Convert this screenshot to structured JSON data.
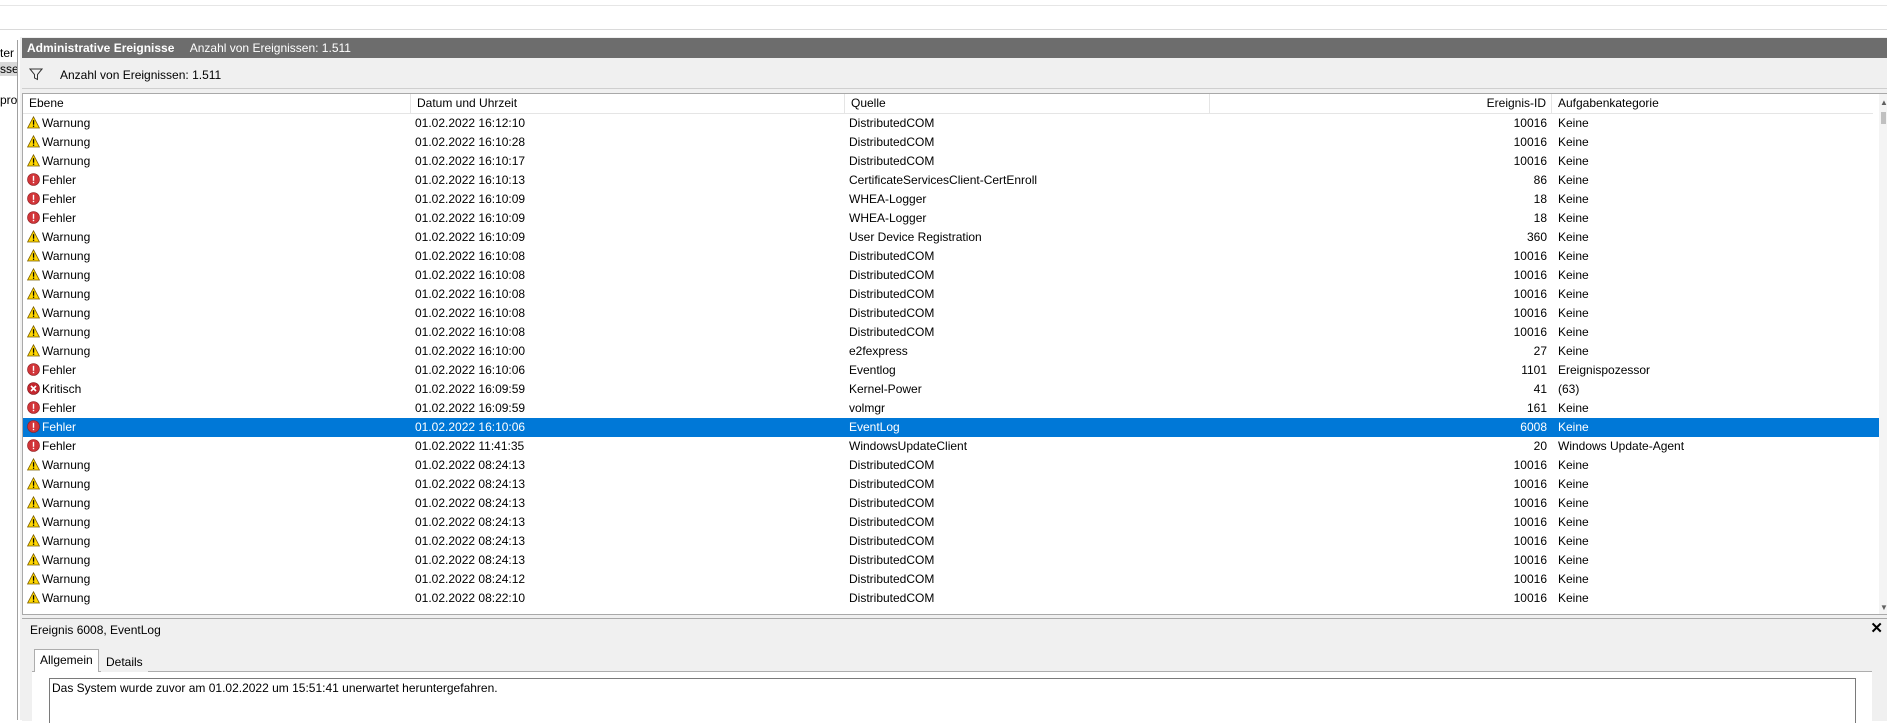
{
  "left_strip": {
    "fragments": [
      "ter",
      "sse",
      "pro"
    ]
  },
  "header": {
    "title": "Administrative Ereignisse",
    "count": "Anzahl von Ereignissen: 1.511"
  },
  "filter": {
    "count": "Anzahl von Ereignissen: 1.511",
    "icon": "filter-icon"
  },
  "columns": {
    "level": "Ebene",
    "date": "Datum und Uhrzeit",
    "source": "Quelle",
    "event_id": "Ereignis-ID",
    "category": "Aufgabenkategorie"
  },
  "events": [
    {
      "level": "Warnung",
      "icon": "warning",
      "date": "01.02.2022 16:12:10",
      "source": "DistributedCOM",
      "id": "10016",
      "category": "Keine"
    },
    {
      "level": "Warnung",
      "icon": "warning",
      "date": "01.02.2022 16:10:28",
      "source": "DistributedCOM",
      "id": "10016",
      "category": "Keine"
    },
    {
      "level": "Warnung",
      "icon": "warning",
      "date": "01.02.2022 16:10:17",
      "source": "DistributedCOM",
      "id": "10016",
      "category": "Keine"
    },
    {
      "level": "Fehler",
      "icon": "error",
      "date": "01.02.2022 16:10:13",
      "source": "CertificateServicesClient-CertEnroll",
      "id": "86",
      "category": "Keine"
    },
    {
      "level": "Fehler",
      "icon": "error",
      "date": "01.02.2022 16:10:09",
      "source": "WHEA-Logger",
      "id": "18",
      "category": "Keine"
    },
    {
      "level": "Fehler",
      "icon": "error",
      "date": "01.02.2022 16:10:09",
      "source": "WHEA-Logger",
      "id": "18",
      "category": "Keine"
    },
    {
      "level": "Warnung",
      "icon": "warning",
      "date": "01.02.2022 16:10:09",
      "source": "User Device Registration",
      "id": "360",
      "category": "Keine"
    },
    {
      "level": "Warnung",
      "icon": "warning",
      "date": "01.02.2022 16:10:08",
      "source": "DistributedCOM",
      "id": "10016",
      "category": "Keine"
    },
    {
      "level": "Warnung",
      "icon": "warning",
      "date": "01.02.2022 16:10:08",
      "source": "DistributedCOM",
      "id": "10016",
      "category": "Keine"
    },
    {
      "level": "Warnung",
      "icon": "warning",
      "date": "01.02.2022 16:10:08",
      "source": "DistributedCOM",
      "id": "10016",
      "category": "Keine"
    },
    {
      "level": "Warnung",
      "icon": "warning",
      "date": "01.02.2022 16:10:08",
      "source": "DistributedCOM",
      "id": "10016",
      "category": "Keine"
    },
    {
      "level": "Warnung",
      "icon": "warning",
      "date": "01.02.2022 16:10:08",
      "source": "DistributedCOM",
      "id": "10016",
      "category": "Keine"
    },
    {
      "level": "Warnung",
      "icon": "warning",
      "date": "01.02.2022 16:10:00",
      "source": "e2fexpress",
      "id": "27",
      "category": "Keine"
    },
    {
      "level": "Fehler",
      "icon": "error",
      "date": "01.02.2022 16:10:06",
      "source": "Eventlog",
      "id": "1101",
      "category": "Ereignispozessor"
    },
    {
      "level": "Kritisch",
      "icon": "critical",
      "date": "01.02.2022 16:09:59",
      "source": "Kernel-Power",
      "id": "41",
      "category": "(63)"
    },
    {
      "level": "Fehler",
      "icon": "error",
      "date": "01.02.2022 16:09:59",
      "source": "volmgr",
      "id": "161",
      "category": "Keine"
    },
    {
      "level": "Fehler",
      "icon": "error",
      "date": "01.02.2022 16:10:06",
      "source": "EventLog",
      "id": "6008",
      "category": "Keine",
      "selected": true
    },
    {
      "level": "Fehler",
      "icon": "error",
      "date": "01.02.2022 11:41:35",
      "source": "WindowsUpdateClient",
      "id": "20",
      "category": "Windows Update-Agent"
    },
    {
      "level": "Warnung",
      "icon": "warning",
      "date": "01.02.2022 08:24:13",
      "source": "DistributedCOM",
      "id": "10016",
      "category": "Keine"
    },
    {
      "level": "Warnung",
      "icon": "warning",
      "date": "01.02.2022 08:24:13",
      "source": "DistributedCOM",
      "id": "10016",
      "category": "Keine"
    },
    {
      "level": "Warnung",
      "icon": "warning",
      "date": "01.02.2022 08:24:13",
      "source": "DistributedCOM",
      "id": "10016",
      "category": "Keine"
    },
    {
      "level": "Warnung",
      "icon": "warning",
      "date": "01.02.2022 08:24:13",
      "source": "DistributedCOM",
      "id": "10016",
      "category": "Keine"
    },
    {
      "level": "Warnung",
      "icon": "warning",
      "date": "01.02.2022 08:24:13",
      "source": "DistributedCOM",
      "id": "10016",
      "category": "Keine"
    },
    {
      "level": "Warnung",
      "icon": "warning",
      "date": "01.02.2022 08:24:13",
      "source": "DistributedCOM",
      "id": "10016",
      "category": "Keine"
    },
    {
      "level": "Warnung",
      "icon": "warning",
      "date": "01.02.2022 08:24:12",
      "source": "DistributedCOM",
      "id": "10016",
      "category": "Keine"
    },
    {
      "level": "Warnung",
      "icon": "warning",
      "date": "01.02.2022 08:22:10",
      "source": "DistributedCOM",
      "id": "10016",
      "category": "Keine"
    }
  ],
  "detail": {
    "title": "Ereignis 6008, EventLog",
    "close_glyph": "✕",
    "tabs": {
      "general": "Allgemein",
      "details": "Details"
    },
    "message": "Das System wurde zuvor am 01.02.2022 um 15:51:41 unerwartet heruntergefahren."
  },
  "colors": {
    "selection": "#0078d7",
    "header_bg": "#6d6d6d",
    "warning": "#ffd700",
    "error": "#d13438"
  }
}
